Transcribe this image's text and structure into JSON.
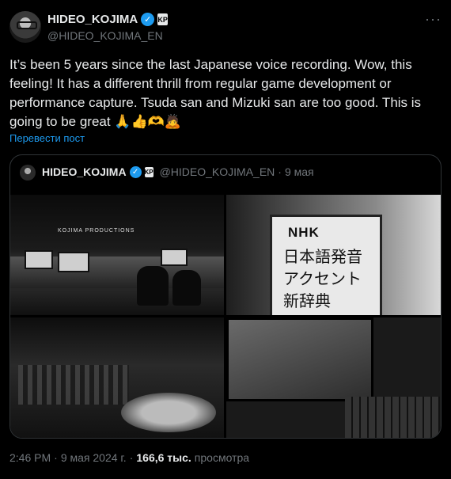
{
  "author": {
    "name": "HIDEO_KOJIMA",
    "handle": "@HIDEO_KOJIMA_EN",
    "verified_glyph": "✓",
    "affiliate_glyph": "KP"
  },
  "tweet": {
    "text": "It’s been 5 years since the last Japanese voice recording. Wow, this feeling! It has a different thrill from regular game development or performance capture. Tsuda san and Mizuki san are too good. This is going to be great 🙏👍🫶🙇",
    "translate_label": "Перевести пост"
  },
  "quote": {
    "name": "HIDEO_KOJIMA",
    "handle": "@HIDEO_KOJIMA_EN",
    "separator": "·",
    "date": "9 мая",
    "studio_sign": "KOJIMA PRODUCTIONS",
    "book": {
      "logo": "NHK",
      "line1": "日本語発音",
      "line2": "アクセント",
      "line3": "新辞典"
    }
  },
  "footer": {
    "time": "2:46 PM",
    "dot1": "·",
    "date": "9 мая 2024 г.",
    "dot2": "·",
    "views": "166,6 тыс.",
    "views_label": "просмотра"
  },
  "more_glyph": "···",
  "colors": {
    "background": "#000000",
    "text": "#e7e9ea",
    "secondary": "#71767b",
    "accent": "#1d9bf0",
    "border": "#2f3336"
  }
}
